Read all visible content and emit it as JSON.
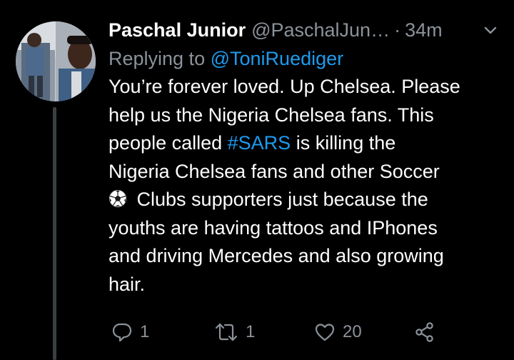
{
  "tweet": {
    "author_name": "Paschal Junior",
    "author_handle": "@PaschalJun…",
    "separator": "·",
    "time": "34m",
    "replying_prefix": "Replying to",
    "replying_handle": "@ToniRuediger",
    "body_lines": [
      "You’re forever loved. Up Chelsea. Please",
      "help us the Nigeria Chelsea fans. This",
      "people called ",
      "#SARS",
      " is killing the",
      "Nigeria Chelsea fans and other Soccer",
      "Clubs supporters just because the",
      "youths are having tattoos and IPhones",
      "and driving Mercedes and also growing",
      "hair."
    ],
    "emoji": "soccer-ball"
  },
  "actions": {
    "reply_count": "1",
    "retweet_count": "1",
    "like_count": "20"
  },
  "icons": {
    "reply": "reply-icon",
    "retweet": "retweet-icon",
    "like": "heart-icon",
    "share": "share-icon",
    "more": "chevron-down-icon"
  },
  "colors": {
    "background": "#000000",
    "text": "#ffffff",
    "muted": "#8b9299",
    "accent": "#1d9bf0"
  }
}
